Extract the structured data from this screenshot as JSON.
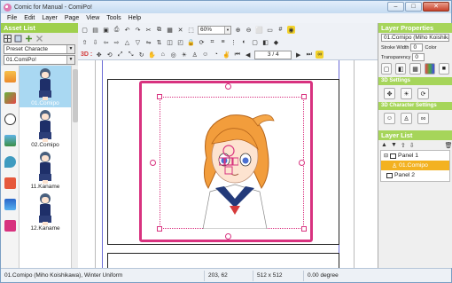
{
  "window": {
    "title": "Comic for Manual - ComiPo!",
    "min": "–",
    "max": "□",
    "close": "✕"
  },
  "menu": [
    "File",
    "Edit",
    "Layer",
    "Page",
    "View",
    "Tools",
    "Help"
  ],
  "asset_list": {
    "title": "Asset List",
    "preset": "Preset Characte",
    "character": "01.ComiPo!",
    "items": [
      "01.Comipo",
      "02.Comipo",
      "11.Kaname",
      "12.Kaname"
    ]
  },
  "toolbar": {
    "zoom": "60%",
    "page": "3 / 4",
    "label3d": "3D :"
  },
  "layer_properties": {
    "title": "Layer Properties",
    "name": "01.Comipo (Miho Koishikawa)",
    "stroke_label": "Stroke Width",
    "stroke_value": "0",
    "color_label": "Color",
    "transparency_label": "Transparency",
    "transparency_value": "0",
    "settings_3d": "3D Settings",
    "char_settings_3d": "3D Character Settings"
  },
  "layer_list": {
    "title": "Layer List",
    "items": [
      "Panel 1",
      "01.Comipo",
      "Panel 2"
    ]
  },
  "status": {
    "name": "01.Comipo (Miho Koishikawa), Winter Uniform",
    "pos": "203, 62",
    "size": "512 x 512",
    "angle": "0.00 degree"
  },
  "colors": {
    "accent": "#a6d55a",
    "selection": "#d8327f",
    "layer_sel": "#f3b221"
  }
}
